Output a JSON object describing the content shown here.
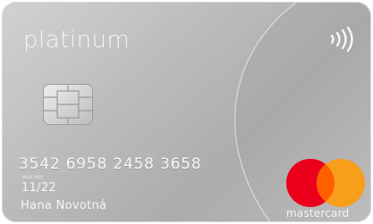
{
  "card": {
    "brand": "platinum",
    "number": "3542 6958 2458 3658",
    "valid_thru_label": "VALID THRU",
    "expiry": "11/22",
    "holder": "Hana Novotná",
    "network": "mastercard"
  },
  "icons": {
    "contactless": "contactless-icon",
    "chip": "chip-icon",
    "network_logo": "mastercard-logo-icon"
  },
  "colors": {
    "card_base": "#b4b4b4",
    "mastercard_red": "#eb001b",
    "mastercard_yellow": "#f79e1b",
    "mastercard_overlap": "#ff5f00"
  }
}
